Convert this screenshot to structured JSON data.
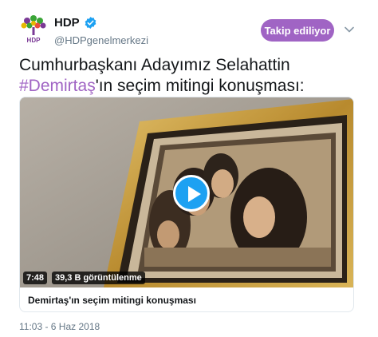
{
  "author": {
    "name": "HDP",
    "handle": "@HDPgenelmerkezi",
    "verified": true,
    "avatar_logo_text": "HDP"
  },
  "follow_button": {
    "label": "Takip ediliyor"
  },
  "menu": {
    "icon": "chevron-down-icon"
  },
  "tweet": {
    "text_line1": "Cumhurbaşkanı Adayımız Selahattin",
    "hashtag": "#Demirtaş",
    "text_after_hashtag": "'ın seçim mitingi konuşması:"
  },
  "video": {
    "duration": "7:48",
    "views": "39,3 B görüntülenme",
    "title": "Demirtaş'ın seçim mitingi konuşması"
  },
  "timestamp": "11:03 - 6 Haz 2018",
  "colors": {
    "accent": "#a064c4",
    "play_button": "#1da1f2",
    "verified": "#1da1f2",
    "logo_green": "#3aa537",
    "logo_purple": "#7b3a96"
  }
}
